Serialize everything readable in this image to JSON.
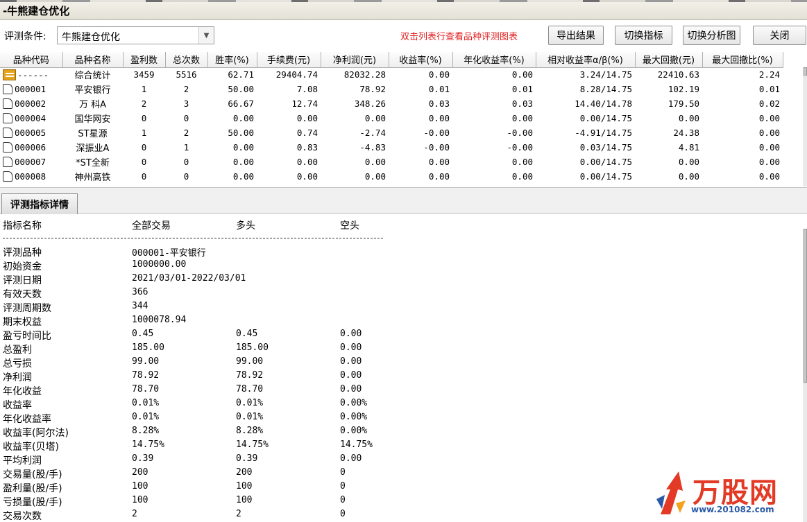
{
  "window": {
    "title": "-牛熊建仓优化"
  },
  "toolbar": {
    "condition_label": "评测条件:",
    "condition_value": "牛熊建仓优化",
    "hint": "双击列表行查看品种评测图表",
    "buttons": [
      "导出结果",
      "切换指标",
      "切换分析图",
      "关闭"
    ]
  },
  "table": {
    "columns": [
      "品种代码",
      "品种名称",
      "盈利数",
      "总次数",
      "胜率(%)",
      "手续费(元)",
      "净利润(元)",
      "收益率(%)",
      "年化收益率(%)",
      "相对收益率α/β(%)",
      "最大回撤(元)",
      "最大回撤比(%)"
    ],
    "rows": [
      [
        "------",
        "综合统计",
        "3459",
        "5516",
        "62.71",
        "29404.74",
        "82032.28",
        "0.00",
        "0.00",
        "3.24/14.75",
        "22410.63",
        "2.24"
      ],
      [
        "000001",
        "平安银行",
        "1",
        "2",
        "50.00",
        "7.08",
        "78.92",
        "0.01",
        "0.01",
        "8.28/14.75",
        "102.19",
        "0.01"
      ],
      [
        "000002",
        "万 科A",
        "2",
        "3",
        "66.67",
        "12.74",
        "348.26",
        "0.03",
        "0.03",
        "14.40/14.78",
        "179.50",
        "0.02"
      ],
      [
        "000004",
        "国华网安",
        "0",
        "0",
        "0.00",
        "0.00",
        "0.00",
        "0.00",
        "0.00",
        "0.00/14.75",
        "0.00",
        "0.00"
      ],
      [
        "000005",
        "ST星源",
        "1",
        "2",
        "50.00",
        "0.74",
        "-2.74",
        "-0.00",
        "-0.00",
        "-4.91/14.75",
        "24.38",
        "0.00"
      ],
      [
        "000006",
        "深振业A",
        "0",
        "1",
        "0.00",
        "0.83",
        "-4.83",
        "-0.00",
        "-0.00",
        "0.03/14.75",
        "4.81",
        "0.00"
      ],
      [
        "000007",
        "*ST全新",
        "0",
        "0",
        "0.00",
        "0.00",
        "0.00",
        "0.00",
        "0.00",
        "0.00/14.75",
        "0.00",
        "0.00"
      ],
      [
        "000008",
        "神州高铁",
        "0",
        "0",
        "0.00",
        "0.00",
        "0.00",
        "0.00",
        "0.00",
        "0.00/14.75",
        "0.00",
        "0.00"
      ]
    ]
  },
  "detail": {
    "tab_label": "评测指标详情",
    "headers": [
      "指标名称",
      "全部交易",
      "多头",
      "空头"
    ],
    "separator": "------------------------------------------------------------------------",
    "rows": [
      [
        "评测品种",
        "000001-平安银行",
        "",
        ""
      ],
      [
        "初始资金",
        "1000000.00",
        "",
        ""
      ],
      [
        "评测日期",
        "2021/03/01-2022/03/01",
        "",
        ""
      ],
      [
        "有效天数",
        "366",
        "",
        ""
      ],
      [
        "评测周期数",
        "344",
        "",
        ""
      ],
      [
        "期末权益",
        "1000078.94",
        "",
        ""
      ],
      [
        "盈亏时间比",
        "0.45",
        "0.45",
        "0.00"
      ],
      [
        "总盈利",
        "185.00",
        "185.00",
        "0.00"
      ],
      [
        "总亏损",
        "99.00",
        "99.00",
        "0.00"
      ],
      [
        "净利润",
        "78.92",
        "78.92",
        "0.00"
      ],
      [
        "年化收益",
        "78.70",
        "78.70",
        "0.00"
      ],
      [
        "收益率",
        "0.01%",
        "0.01%",
        "0.00%"
      ],
      [
        "年化收益率",
        "0.01%",
        "0.01%",
        "0.00%"
      ],
      [
        "收益率(阿尔法)",
        "8.28%",
        "8.28%",
        "0.00%"
      ],
      [
        "收益率(贝塔)",
        "14.75%",
        "14.75%",
        "14.75%"
      ],
      [
        "平均利润",
        "0.39",
        "0.39",
        "0.00"
      ],
      [
        "交易量(股/手)",
        "200",
        "200",
        "0"
      ],
      [
        "盈利量(股/手)",
        "100",
        "100",
        "0"
      ],
      [
        "亏损量(股/手)",
        "100",
        "100",
        "0"
      ],
      [
        "交易次数",
        "2",
        "2",
        "0"
      ]
    ]
  },
  "watermark": {
    "name": "万股网",
    "url": "www.201082.com"
  }
}
